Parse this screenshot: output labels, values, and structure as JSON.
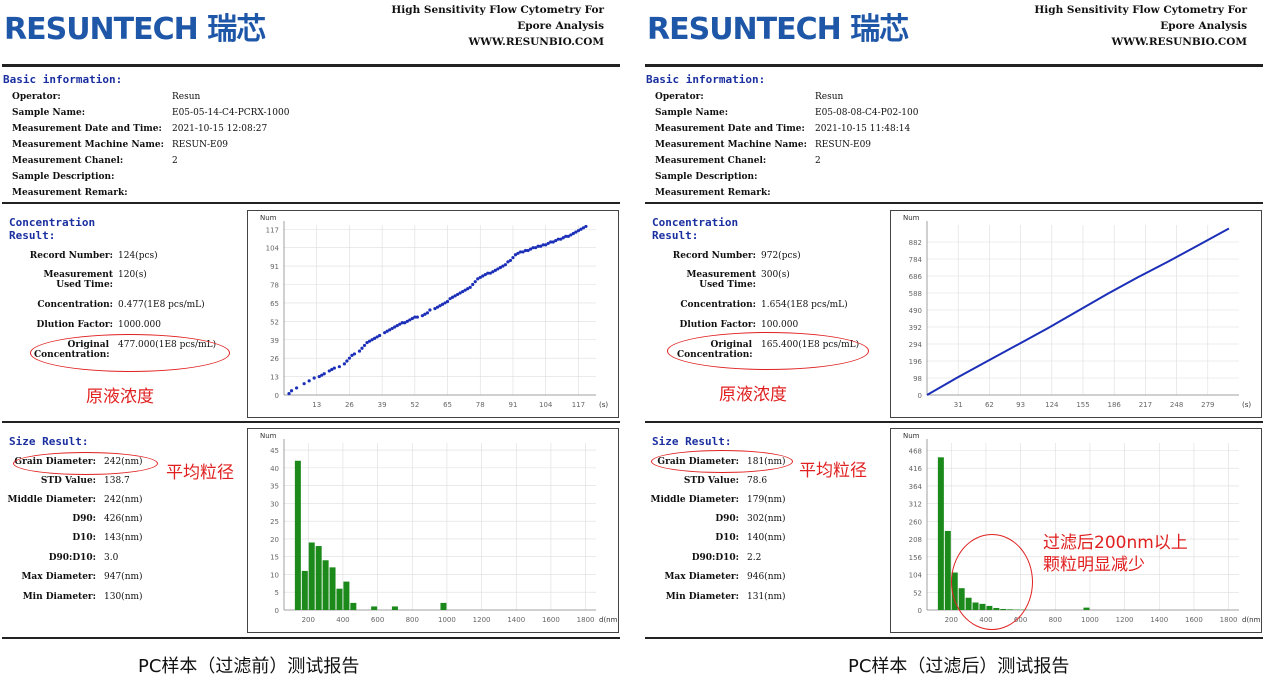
{
  "reports": [
    {
      "logo": "RESUNTECH 瑞芯",
      "header_lines": [
        "High Sensitivity Flow Cytometry For",
        "Epore Analysis",
        "WWW.RESUNBIO.COM"
      ],
      "basic_title": "Basic information:",
      "basic": [
        {
          "k": "Operator:",
          "v": "Resun"
        },
        {
          "k": "Sample Name:",
          "v": "E05-05-14-C4-PCRX-1000"
        },
        {
          "k": "Measurement Date and Time:",
          "v": "2021-10-15 12:08:27"
        },
        {
          "k": "Measurement Machine Name:",
          "v": "RESUN-E09"
        },
        {
          "k": "Measurement Chanel:",
          "v": "2"
        },
        {
          "k": "Sample Description:",
          "v": ""
        },
        {
          "k": "Measurement Remark:",
          "v": ""
        }
      ],
      "conc_title": [
        "Concentration",
        "Result:"
      ],
      "conc": [
        {
          "k": "Record Number:",
          "v": "124(pcs)"
        },
        {
          "k": "Measurement Used Time:",
          "v": "120(s)"
        },
        {
          "k": "Concentration:",
          "v": "0.477(1E8 pcs/mL)"
        },
        {
          "k": "Dlution Factor:",
          "v": "1000.000"
        },
        {
          "k": "Original Concentration:",
          "v": "477.000(1E8 pcs/mL)"
        }
      ],
      "conc_note": "原液浓度",
      "size_title": "Size Result:",
      "size": [
        {
          "k": "Grain Diameter:",
          "v": "242(nm)"
        },
        {
          "k": "STD Value:",
          "v": "138.7"
        },
        {
          "k": "Middle Diameter:",
          "v": "242(nm)"
        },
        {
          "k": "D90:",
          "v": "426(nm)"
        },
        {
          "k": "D10:",
          "v": "143(nm)"
        },
        {
          "k": "D90:D10:",
          "v": "3.0"
        },
        {
          "k": "Max Diameter:",
          "v": "947(nm)"
        },
        {
          "k": "Min Diameter:",
          "v": "130(nm)"
        }
      ],
      "size_note": "平均粒径",
      "extra_note": "",
      "caption": "PC样本（过滤前）测试报告"
    },
    {
      "logo": "RESUNTECH 瑞芯",
      "header_lines": [
        "High Sensitivity Flow Cytometry For",
        "Epore Analysis",
        "WWW.RESUNBIO.COM"
      ],
      "basic_title": "Basic information:",
      "basic": [
        {
          "k": "Operator:",
          "v": "Resun"
        },
        {
          "k": "Sample Name:",
          "v": "E05-08-08-C4-P02-100"
        },
        {
          "k": "Measurement Date and Time:",
          "v": "2021-10-15 11:48:14"
        },
        {
          "k": "Measurement Machine Name:",
          "v": "RESUN-E09"
        },
        {
          "k": "Measurement Chanel:",
          "v": "2"
        },
        {
          "k": "Sample Description:",
          "v": ""
        },
        {
          "k": "Measurement Remark:",
          "v": ""
        }
      ],
      "conc_title": [
        "Concentration",
        "Result:"
      ],
      "conc": [
        {
          "k": "Record Number:",
          "v": "972(pcs)"
        },
        {
          "k": "Measurement Used Time:",
          "v": "300(s)"
        },
        {
          "k": "Concentration:",
          "v": "1.654(1E8 pcs/mL)"
        },
        {
          "k": "Dlution Factor:",
          "v": "100.000"
        },
        {
          "k": "Original Concentration:",
          "v": "165.400(1E8 pcs/mL)"
        }
      ],
      "conc_note": "原液浓度",
      "size_title": "Size Result:",
      "size": [
        {
          "k": "Grain Diameter:",
          "v": "181(nm)"
        },
        {
          "k": "STD Value:",
          "v": "78.6"
        },
        {
          "k": "Middle Diameter:",
          "v": "179(nm)"
        },
        {
          "k": "D90:",
          "v": "302(nm)"
        },
        {
          "k": "D10:",
          "v": "140(nm)"
        },
        {
          "k": "D90:D10:",
          "v": "2.2"
        },
        {
          "k": "Max Diameter:",
          "v": "946(nm)"
        },
        {
          "k": "Min Diameter:",
          "v": "131(nm)"
        }
      ],
      "size_note": "平均粒径",
      "extra_note": [
        "过滤后200nm以上",
        "颗粒明显减少"
      ],
      "caption": "PC样本（过滤后）测试报告"
    }
  ],
  "chart_data": [
    {
      "type": "scatter",
      "ylabel": "Num",
      "xlabel": "(s)",
      "xticks": [
        13,
        26,
        39,
        52,
        65,
        78,
        91,
        104,
        117
      ],
      "yticks": [
        0,
        13,
        26,
        39,
        52,
        65,
        78,
        91,
        104,
        117
      ],
      "xlim": [
        0,
        124
      ],
      "ylim": [
        0,
        120
      ],
      "x": [
        2,
        3,
        5,
        8,
        10,
        12,
        14,
        15,
        16,
        18,
        19,
        20,
        22,
        24,
        25,
        26,
        27,
        28,
        30,
        31,
        32,
        33,
        34,
        35,
        36,
        37,
        38,
        40,
        41,
        42,
        43,
        44,
        45,
        46,
        47,
        48,
        49,
        50,
        51,
        52,
        53,
        55,
        56,
        57,
        58,
        60,
        61,
        62,
        63,
        64,
        65,
        66,
        67,
        68,
        69,
        70,
        71,
        72,
        73,
        74,
        75,
        76,
        77,
        78,
        79,
        80,
        81,
        82,
        83,
        84,
        85,
        86,
        87,
        88,
        89,
        90,
        91,
        92,
        93,
        94,
        95,
        96,
        97,
        98,
        99,
        100,
        101,
        102,
        103,
        104,
        105,
        106,
        107,
        108,
        109,
        110,
        111,
        112,
        113,
        114,
        115,
        116,
        117,
        118,
        119,
        120
      ],
      "y": [
        1,
        3,
        5,
        8,
        10,
        12,
        13,
        14,
        15,
        17,
        18,
        19,
        20,
        22,
        24,
        26,
        28,
        29,
        31,
        33,
        35,
        37,
        38,
        39,
        40,
        41,
        42,
        44,
        45,
        46,
        47,
        48,
        49,
        50,
        51,
        51,
        52,
        53,
        54,
        55,
        55,
        56,
        57,
        58,
        60,
        61,
        62,
        63,
        64,
        65,
        66,
        68,
        69,
        70,
        71,
        72,
        73,
        74,
        75,
        76,
        78,
        80,
        82,
        83,
        84,
        85,
        86,
        86,
        87,
        88,
        89,
        90,
        91,
        92,
        94,
        95,
        97,
        99,
        100,
        101,
        101,
        102,
        102,
        103,
        104,
        104,
        105,
        105,
        106,
        106,
        107,
        108,
        108,
        109,
        110,
        110,
        111,
        112,
        112,
        113,
        114,
        115,
        116,
        117,
        118,
        119
      ]
    },
    {
      "type": "bar",
      "ylabel": "Num",
      "xlabel": "d(nm)",
      "xticks": [
        200,
        400,
        600,
        800,
        1000,
        1200,
        1400,
        1600,
        1800
      ],
      "yticks": [
        0,
        5,
        10,
        15,
        20,
        25,
        30,
        35,
        40,
        45
      ],
      "xlim": [
        60,
        1860
      ],
      "ylim": [
        0,
        47
      ],
      "bins_nm": [
        140,
        180,
        220,
        260,
        300,
        340,
        380,
        420,
        460,
        500,
        540,
        580,
        620,
        660,
        700,
        740,
        780,
        820,
        860,
        900,
        940,
        980
      ],
      "values": [
        42,
        11,
        19,
        18,
        14,
        12,
        6,
        8,
        2,
        0,
        0,
        1,
        0,
        0,
        1,
        0,
        0,
        0,
        0,
        0,
        0,
        2
      ]
    },
    {
      "type": "line",
      "ylabel": "Num",
      "xlabel": "(s)",
      "xticks": [
        31,
        62,
        93,
        124,
        155,
        186,
        217,
        248,
        279
      ],
      "yticks": [
        0,
        98,
        196,
        294,
        392,
        490,
        588,
        686,
        784,
        882
      ],
      "xlim": [
        0,
        310
      ],
      "ylim": [
        0,
        980
      ],
      "x": [
        0,
        30,
        60,
        90,
        120,
        150,
        180,
        210,
        240,
        270,
        300
      ],
      "y": [
        0,
        100,
        195,
        290,
        385,
        485,
        585,
        680,
        770,
        865,
        960
      ]
    },
    {
      "type": "bar",
      "ylabel": "Num",
      "xlabel": "d(nm)",
      "xticks": [
        200,
        400,
        600,
        800,
        1000,
        1200,
        1400,
        1600,
        1800
      ],
      "yticks": [
        0,
        52,
        104,
        156,
        208,
        260,
        312,
        364,
        416,
        468
      ],
      "xlim": [
        60,
        1860
      ],
      "ylim": [
        0,
        490
      ],
      "bins_nm": [
        140,
        180,
        220,
        260,
        300,
        340,
        380,
        420,
        460,
        500,
        540,
        580,
        620,
        660,
        700,
        740,
        780,
        820,
        860,
        900,
        940,
        980
      ],
      "values": [
        448,
        232,
        110,
        64,
        36,
        22,
        18,
        12,
        6,
        3,
        2,
        1,
        1,
        0,
        0,
        0,
        0,
        0,
        0,
        0,
        0,
        7
      ]
    }
  ]
}
